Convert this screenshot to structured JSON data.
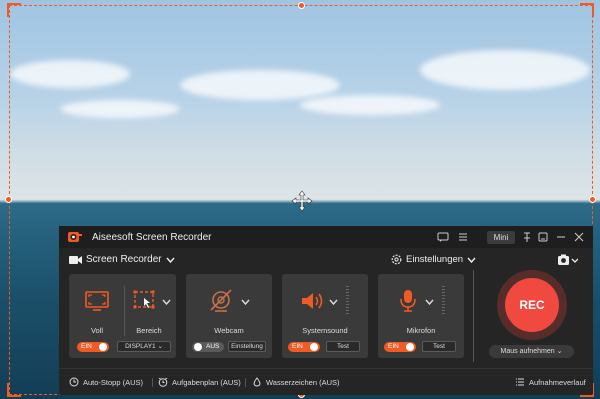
{
  "app": {
    "title": "Aiseesoft Screen Recorder",
    "mini_label": "Mini"
  },
  "mode": {
    "label": "Screen Recorder"
  },
  "settings": {
    "label": "Einstellungen"
  },
  "screen_card": {
    "full_label": "Voll",
    "area_label": "Bereich",
    "toggle_label": "EIN",
    "display_value": "DISPLAY1"
  },
  "webcam_card": {
    "label": "Webcam",
    "toggle_label": "AUS",
    "settings_label": "Einstellung"
  },
  "system_sound_card": {
    "label": "Systemsound",
    "toggle_label": "EIN",
    "test_label": "Test"
  },
  "mic_card": {
    "label": "Mikrofon",
    "toggle_label": "EIN",
    "test_label": "Test"
  },
  "record": {
    "rec_label": "REC",
    "follow_mouse_label": "Maus aufnehmen"
  },
  "footer": {
    "auto_stop": "Auto-Stopp (AUS)",
    "schedule": "Aufgabenplan (AUS)",
    "watermark": "Wasserzeichen (AUS)",
    "history": "Aufnahmeverlauf"
  },
  "colors": {
    "accent": "#f05a24",
    "rec": "#f04a40",
    "panel_bg": "#252525",
    "card_bg": "#3a3a3a"
  }
}
